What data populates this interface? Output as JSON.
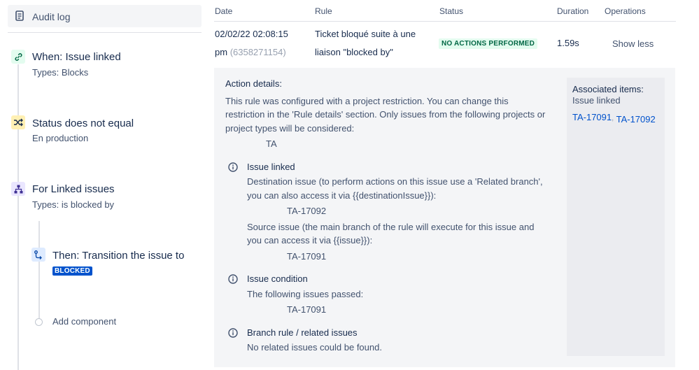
{
  "sidebar": {
    "audit_log_label": "Audit log",
    "when": {
      "title": "When: Issue linked",
      "subtitle": "Types: Blocks"
    },
    "condition": {
      "title": "Status does not equal",
      "subtitle": "En production"
    },
    "branch": {
      "title": "For Linked issues",
      "subtitle": "Types: is blocked by"
    },
    "action": {
      "title": "Then: Transition the issue to",
      "badge": "BLOCKED"
    },
    "add_component_label": "Add component"
  },
  "table": {
    "headers": {
      "date": "Date",
      "rule": "Rule",
      "status": "Status",
      "duration": "Duration",
      "operations": "Operations"
    },
    "row": {
      "date_line1": "02/02/22 02:08:15",
      "date_line2": "pm",
      "id": "(6358271154)",
      "rule_line1": "Ticket bloqué suite à une",
      "rule_line2": "liaison \"blocked by\"",
      "status": "NO ACTIONS PERFORMED",
      "duration": "1.59s",
      "operation": "Show less"
    }
  },
  "details": {
    "heading": "Action details:",
    "restriction_line1": "This rule was configured with a project restriction. You can change this",
    "restriction_line2": "restriction in the 'Rule details' section. Only issues from the following projects or",
    "restriction_line3": "project types will be considered:",
    "project": "TA",
    "sections": [
      {
        "title": "Issue linked",
        "dest_line1": "Destination issue (to perform actions on this issue use a 'Related branch',",
        "dest_line2": "you can also access it via {{destinationIssue}}):",
        "dest_value": "TA-17092",
        "src_line1": "Source issue (the main branch of the rule will execute for this issue and",
        "src_line2": "you can access it via {{issue}}):",
        "src_value": "TA-17091"
      },
      {
        "title": "Issue condition",
        "line1": "The following issues passed:",
        "value": "TA-17091"
      },
      {
        "title": "Branch rule / related issues",
        "line1": "No related issues could be found."
      }
    ],
    "associated": {
      "title": "Associated items:",
      "subtitle": "Issue linked",
      "items": [
        "TA-17091",
        "TA-17092"
      ],
      "separator": ","
    }
  },
  "colors": {
    "link": "#0052cc",
    "status_bg": "#e3fcef",
    "status_text": "#006644",
    "badge_bg": "#0052cc",
    "panel_bg": "#f4f5f7"
  },
  "icons": [
    "document-icon",
    "link-icon",
    "shuffle-icon",
    "branch-icon",
    "transition-icon",
    "info-icon"
  ]
}
